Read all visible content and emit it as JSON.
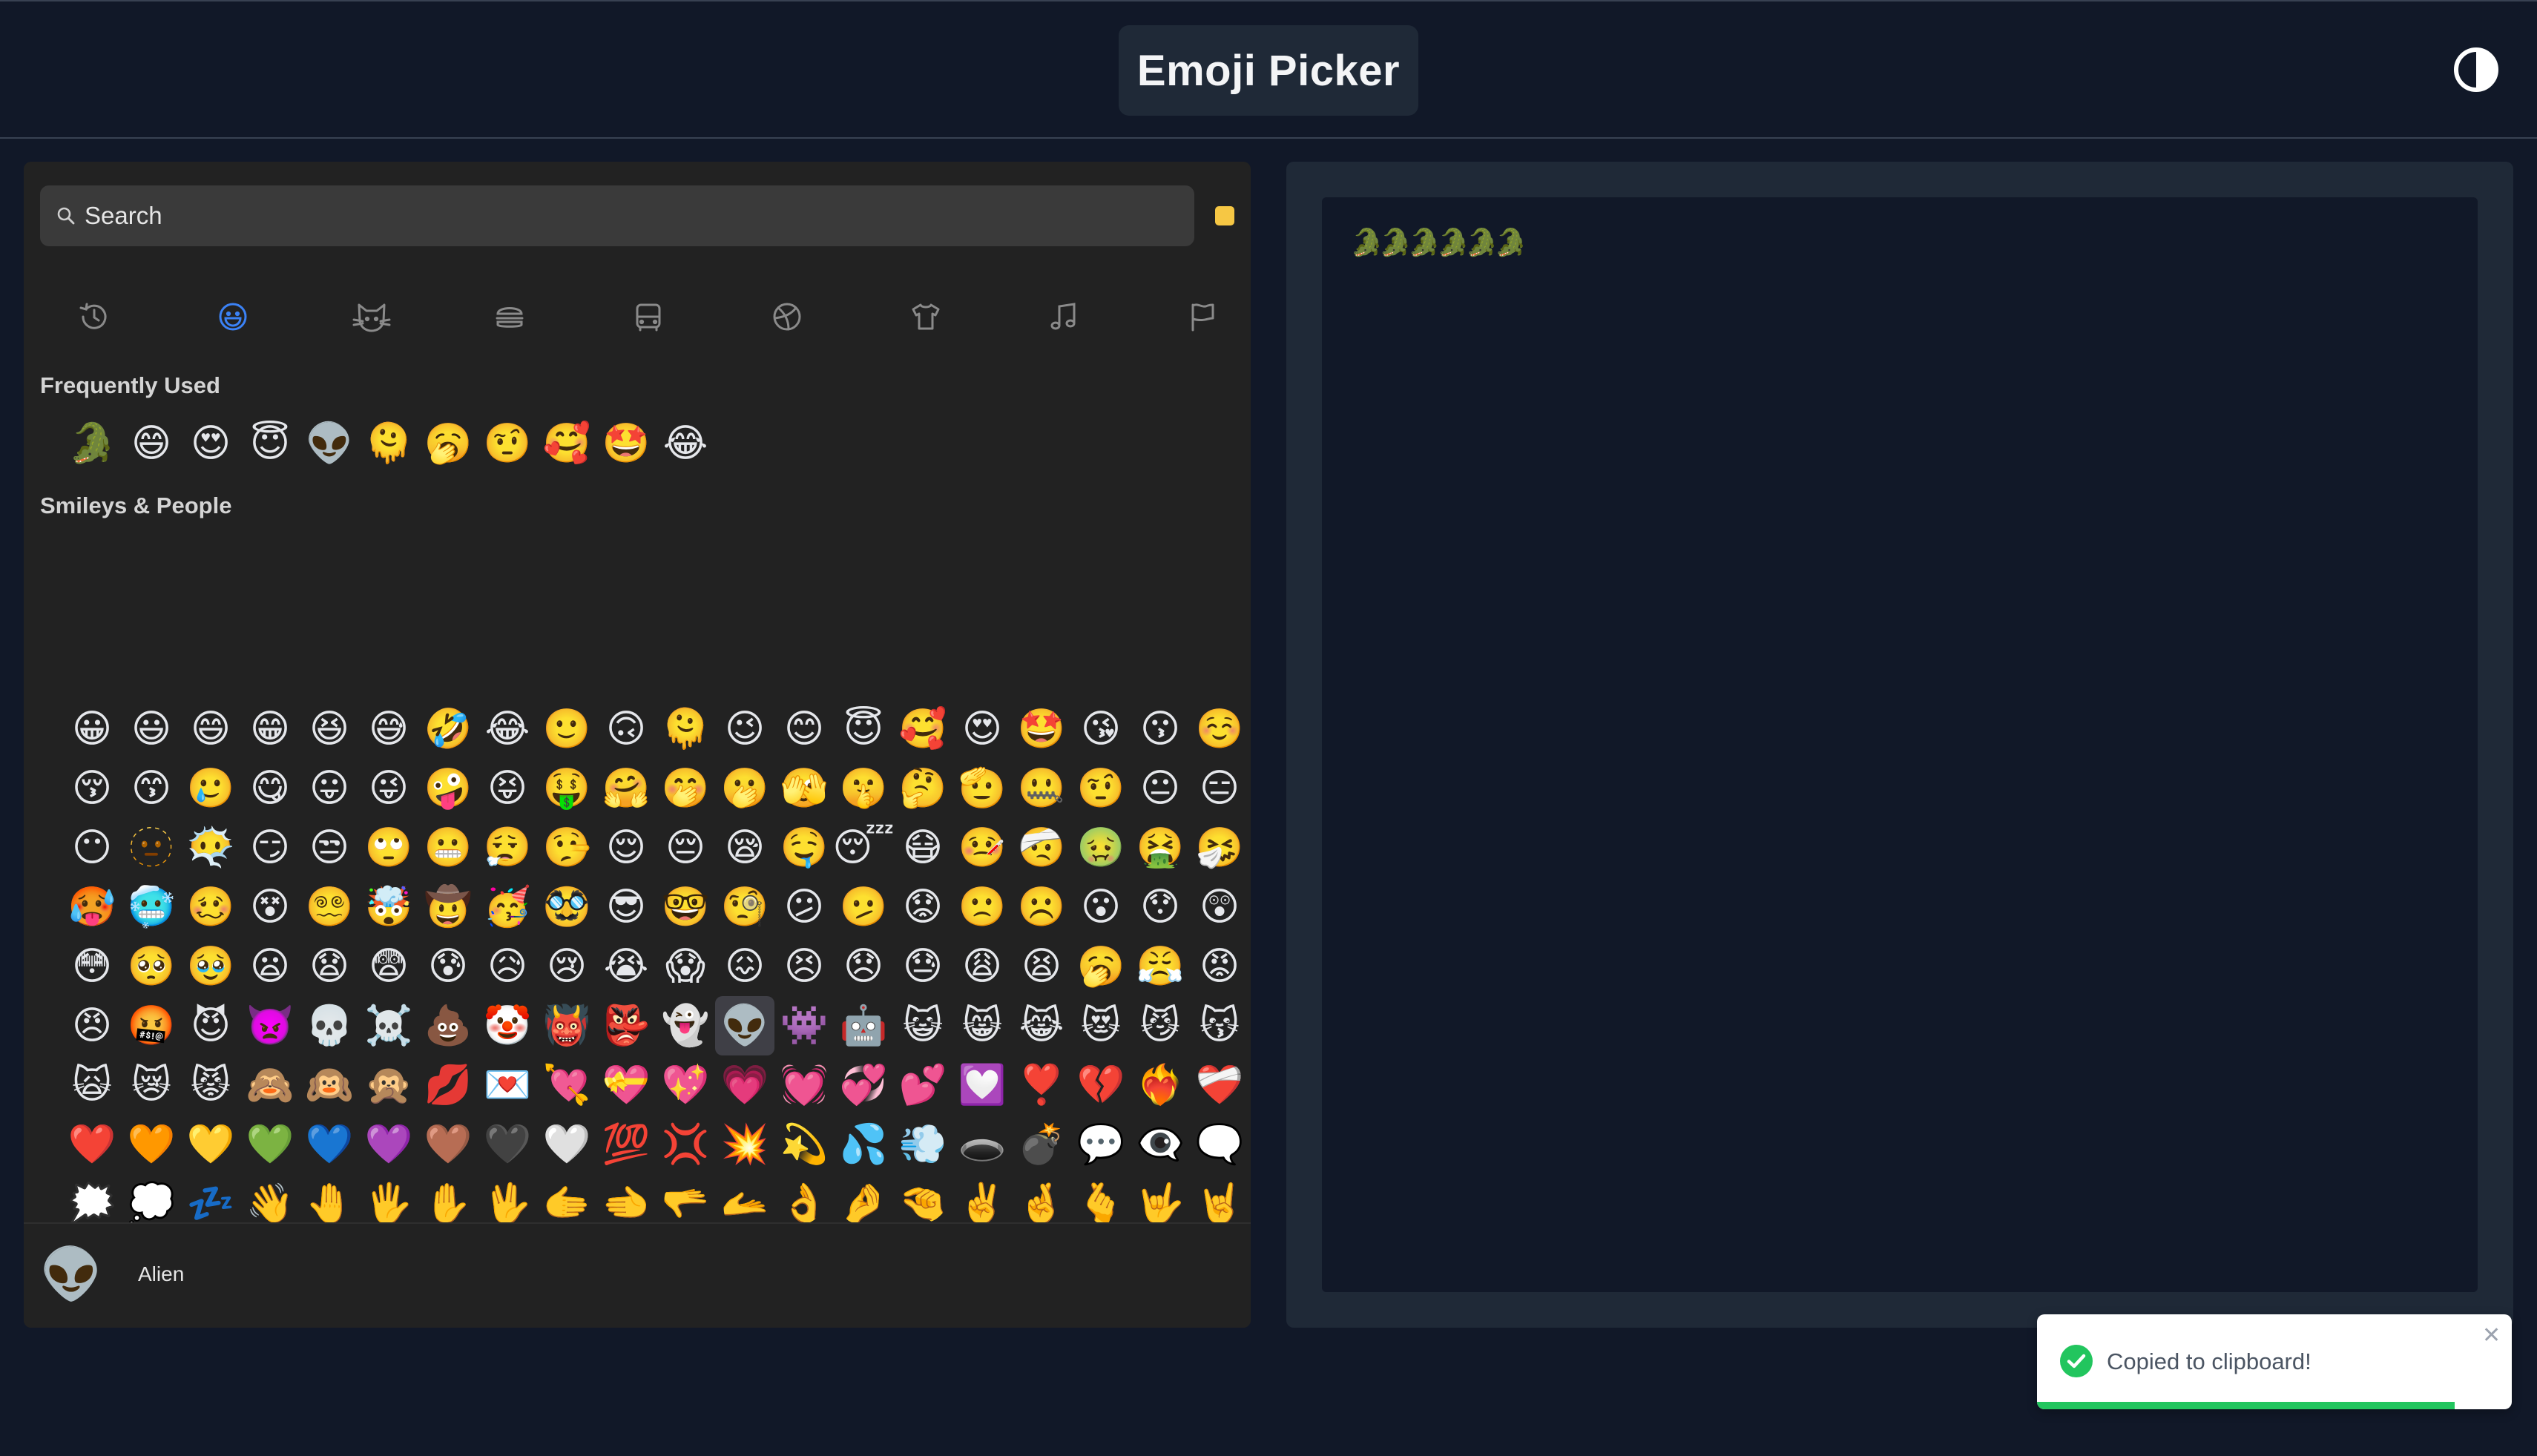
{
  "header": {
    "title": "Emoji Picker",
    "theme_toggle_icon": "contrast-icon"
  },
  "picker": {
    "search_placeholder": "Search",
    "skin_tone_color": "#f6c744",
    "categories": [
      {
        "name": "recent",
        "icon": "clock-icon"
      },
      {
        "name": "smileys",
        "icon": "smiley-icon",
        "active": true
      },
      {
        "name": "animals",
        "icon": "cat-icon"
      },
      {
        "name": "food",
        "icon": "burger-icon"
      },
      {
        "name": "travel",
        "icon": "bus-icon"
      },
      {
        "name": "activities",
        "icon": "ball-icon"
      },
      {
        "name": "objects",
        "icon": "shirt-icon"
      },
      {
        "name": "symbols",
        "icon": "music-note-icon"
      },
      {
        "name": "flags",
        "icon": "flag-icon"
      }
    ],
    "active_color": "#3b82f6",
    "frequent_title": "Frequently Used",
    "frequent": [
      "🐊",
      "😄",
      "😍",
      "😇",
      "👽",
      "🫠",
      "🥱",
      "🤨",
      "🥰",
      "🤩",
      "😂"
    ],
    "smileys_title": "Smileys & People",
    "smileys": [
      "😀",
      "😃",
      "😄",
      "😁",
      "😆",
      "😅",
      "🤣",
      "😂",
      "🙂",
      "🙃",
      "🫠",
      "😉",
      "😊",
      "😇",
      "🥰",
      "😍",
      "🤩",
      "😘",
      "😗",
      "☺️",
      "😚",
      "😙",
      "🥲",
      "😋",
      "😛",
      "😜",
      "🤪",
      "😝",
      "🤑",
      "🤗",
      "🤭",
      "🫢",
      "🫣",
      "🤫",
      "🤔",
      "🫡",
      "🤐",
      "🤨",
      "😐",
      "😑",
      "😶",
      "🫥",
      "😶‍🌫️",
      "😏",
      "😒",
      "🙄",
      "😬",
      "😮‍💨",
      "🤥",
      "😌",
      "😔",
      "😪",
      "🤤",
      "😴",
      "😷",
      "🤒",
      "🤕",
      "🤢",
      "🤮",
      "🤧",
      "🥵",
      "🥶",
      "🥴",
      "😵",
      "😵‍💫",
      "🤯",
      "🤠",
      "🥳",
      "🥸",
      "😎",
      "🤓",
      "🧐",
      "😕",
      "🫤",
      "😟",
      "🙁",
      "☹️",
      "😮",
      "😯",
      "😲",
      "😳",
      "🥺",
      "🥹",
      "😦",
      "😧",
      "😨",
      "😰",
      "😥",
      "😢",
      "😭",
      "😱",
      "😖",
      "😣",
      "😞",
      "😓",
      "😩",
      "😫",
      "🥱",
      "😤",
      "😡",
      "😠",
      "🤬",
      "😈",
      "👿",
      "💀",
      "☠️",
      "💩",
      "🤡",
      "👹",
      "👺",
      "👻",
      "👽",
      "👾",
      "🤖",
      "😺",
      "😸",
      "😹",
      "😻",
      "😼",
      "😽",
      "🙀",
      "😿",
      "😾",
      "🙈",
      "🙉",
      "🙊",
      "💋",
      "💌",
      "💘",
      "💝",
      "💖",
      "💗",
      "💓",
      "💞",
      "💕",
      "💟",
      "❣️",
      "💔",
      "❤️‍🔥",
      "❤️‍🩹",
      "❤️",
      "🧡",
      "💛",
      "💚",
      "💙",
      "💜",
      "🤎",
      "🖤",
      "🤍",
      "💯",
      "💢",
      "💥",
      "💫",
      "💦",
      "💨",
      "🕳️",
      "💣",
      "💬",
      "👁️‍🗨️",
      "🗨️",
      "🗯️",
      "💭",
      "💤",
      "👋",
      "🤚",
      "🖐️",
      "✋",
      "🖖",
      "🫱",
      "🫲",
      "🫳",
      "🫴",
      "👌",
      "🤌",
      "🤏",
      "✌️",
      "🤞",
      "🫰",
      "🤟",
      "🤘",
      "🤙",
      "👈",
      "👉",
      "👆",
      "🖕",
      "👇",
      "☝️",
      "🫵",
      "👍",
      "👎",
      "✊",
      "👊",
      "🤛",
      "🤜",
      "👏",
      "🙌",
      "🫶",
      "👐",
      "🤲",
      "🤝",
      "🙏",
      "✍️",
      "💅",
      "🤳",
      "💪",
      "🦾",
      "🦿",
      "🦵",
      "🦶",
      "👂",
      "🦻",
      "👃",
      "🧠",
      "🫀",
      "🫁",
      "🦷",
      "🦴",
      "👀",
      "👁️",
      "👅",
      "👄",
      "🫦",
      "👶",
      "🧒",
      "👦",
      "👧",
      "🧑",
      "👱",
      "👨",
      "🧔",
      "👩",
      "🧓",
      "👴",
      "👵",
      "🙍",
      "🙎",
      "🙅",
      "🙆",
      "💁",
      "🙋"
    ],
    "active_emoji_index": 111,
    "preview": {
      "emoji": "👽",
      "name": "Alien"
    }
  },
  "output": {
    "text": "🐊🐊🐊🐊🐊🐊"
  },
  "toast": {
    "message": "Copied to clipboard!",
    "progress": 0.88,
    "check_color": "#22c55e"
  }
}
